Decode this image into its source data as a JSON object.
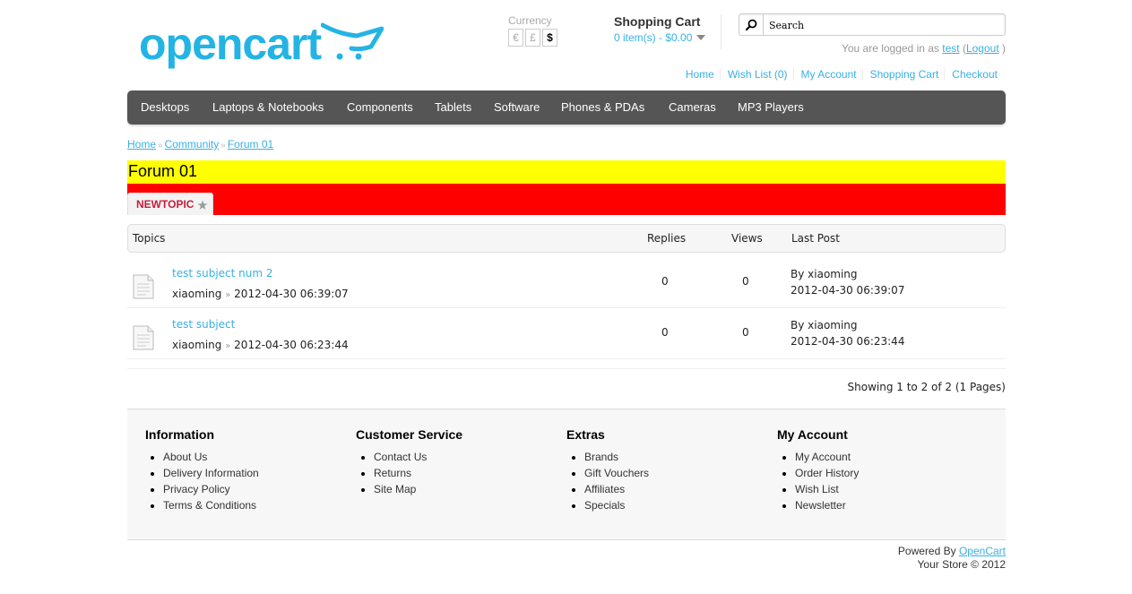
{
  "header": {
    "logo_text": "opencart",
    "currency": {
      "label": "Currency",
      "options": [
        "€",
        "£",
        "$"
      ],
      "selected": "$"
    },
    "cart": {
      "title": "Shopping Cart",
      "summary": "0 item(s) - $0.00"
    },
    "search": {
      "placeholder": "Search"
    },
    "welcome": {
      "prefix": "You are logged in as",
      "user": "test",
      "open_paren": "(",
      "logout": "Logout",
      "close_paren": ")"
    },
    "links": [
      "Home",
      "Wish List (0)",
      "My Account",
      "Shopping Cart",
      "Checkout"
    ]
  },
  "menu": [
    "Desktops",
    "Laptops & Notebooks",
    "Components",
    "Tablets",
    "Software",
    "Phones & PDAs",
    "Cameras",
    "MP3 Players"
  ],
  "breadcrumb": {
    "items": [
      "Home",
      "Community",
      "Forum 01"
    ],
    "separator": "»"
  },
  "forum": {
    "title": "Forum 01",
    "new_topic_label": "NEWTOPIC"
  },
  "topics_table": {
    "headers": {
      "topics": "Topics",
      "replies": "Replies",
      "views": "Views",
      "last_post": "Last Post"
    },
    "rows": [
      {
        "subject": "test subject num 2",
        "author": "xiaoming",
        "separator": "»",
        "date": "2012-04-30 06:39:07",
        "replies": "0",
        "views": "0",
        "last_post_by": "By xiaoming",
        "last_post_date": "2012-04-30 06:39:07"
      },
      {
        "subject": "test subject",
        "author": "xiaoming",
        "separator": "»",
        "date": "2012-04-30 06:23:44",
        "replies": "0",
        "views": "0",
        "last_post_by": "By xiaoming",
        "last_post_date": "2012-04-30 06:23:44"
      }
    ],
    "pagination": "Showing 1 to 2 of 2 (1 Pages)"
  },
  "footer": {
    "columns": [
      {
        "title": "Information",
        "items": [
          "About Us",
          "Delivery Information",
          "Privacy Policy",
          "Terms & Conditions"
        ]
      },
      {
        "title": "Customer Service",
        "items": [
          "Contact Us",
          "Returns",
          "Site Map"
        ]
      },
      {
        "title": "Extras",
        "items": [
          "Brands",
          "Gift Vouchers",
          "Affiliates",
          "Specials"
        ]
      },
      {
        "title": "My Account",
        "items": [
          "My Account",
          "Order History",
          "Wish List",
          "Newsletter"
        ]
      }
    ],
    "powered_by_prefix": "Powered By",
    "powered_by_link": "OpenCart",
    "copyright": "Your Store © 2012"
  }
}
